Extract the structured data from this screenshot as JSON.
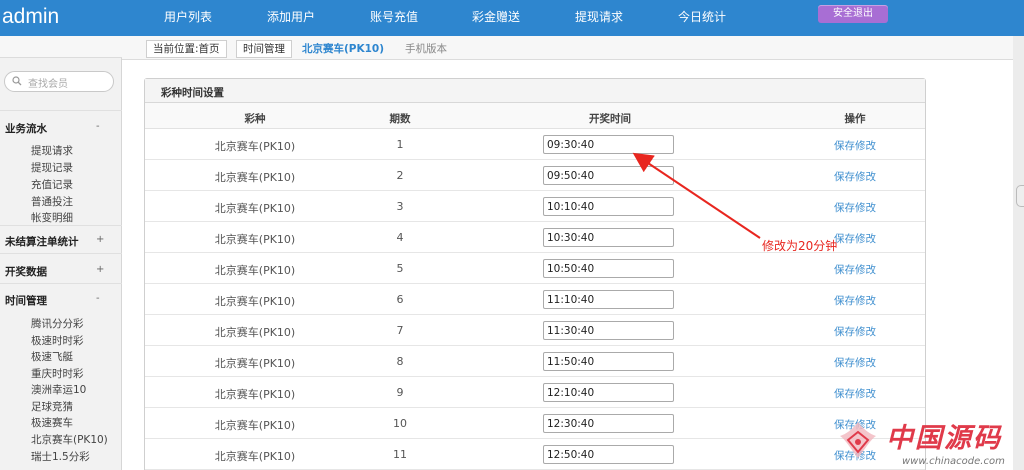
{
  "brand": "admin",
  "nav": [
    "用户列表",
    "添加用户",
    "账号充值",
    "彩金赠送",
    "提现请求",
    "今日统计"
  ],
  "logout_label": "安全退出",
  "search": {
    "placeholder": "查找会员"
  },
  "sidebar": {
    "groups": [
      {
        "label": "业务流水",
        "toggle": "-",
        "items": [
          "提现请求",
          "提现记录",
          "充值记录",
          "普通投注",
          "帐变明细"
        ]
      },
      {
        "label": "未结算注单统计",
        "toggle": "+",
        "items": []
      },
      {
        "label": "开奖数据",
        "toggle": "+",
        "items": []
      },
      {
        "label": "时间管理",
        "toggle": "-",
        "items": [
          "腾讯分分彩",
          "极速时时彩",
          "极速飞艇",
          "重庆时时彩",
          "澳洲幸运10",
          "足球竞猜",
          "极速赛车",
          "北京赛车(PK10)",
          "瑞士1.5分彩"
        ]
      }
    ]
  },
  "breadcrumb": {
    "home": "当前位置:首页",
    "section": "时间管理",
    "current": "北京赛车(PK10)",
    "ghost": "手机版本"
  },
  "panel": {
    "title": "彩种时间设置",
    "columns": [
      "彩种",
      "期数",
      "开奖时间",
      "操作"
    ],
    "rows": [
      {
        "lottery": "北京赛车(PK10)",
        "issue": "1",
        "time": "09:30:40",
        "action": "保存修改"
      },
      {
        "lottery": "北京赛车(PK10)",
        "issue": "2",
        "time": "09:50:40",
        "action": "保存修改"
      },
      {
        "lottery": "北京赛车(PK10)",
        "issue": "3",
        "time": "10:10:40",
        "action": "保存修改"
      },
      {
        "lottery": "北京赛车(PK10)",
        "issue": "4",
        "time": "10:30:40",
        "action": "保存修改"
      },
      {
        "lottery": "北京赛车(PK10)",
        "issue": "5",
        "time": "10:50:40",
        "action": "保存修改"
      },
      {
        "lottery": "北京赛车(PK10)",
        "issue": "6",
        "time": "11:10:40",
        "action": "保存修改"
      },
      {
        "lottery": "北京赛车(PK10)",
        "issue": "7",
        "time": "11:30:40",
        "action": "保存修改"
      },
      {
        "lottery": "北京赛车(PK10)",
        "issue": "8",
        "time": "11:50:40",
        "action": "保存修改"
      },
      {
        "lottery": "北京赛车(PK10)",
        "issue": "9",
        "time": "12:10:40",
        "action": "保存修改"
      },
      {
        "lottery": "北京赛车(PK10)",
        "issue": "10",
        "time": "12:30:40",
        "action": "保存修改"
      },
      {
        "lottery": "北京赛车(PK10)",
        "issue": "11",
        "time": "12:50:40",
        "action": "保存修改"
      }
    ]
  },
  "annotation": {
    "text": "修改为20分钟",
    "color": "#e8261f"
  },
  "watermark": {
    "text": "中国源码",
    "url": "www.chinacode.com"
  },
  "colors": {
    "header": "#2e86cf",
    "logout": "#a86ed4",
    "link": "#3f8fcf"
  }
}
